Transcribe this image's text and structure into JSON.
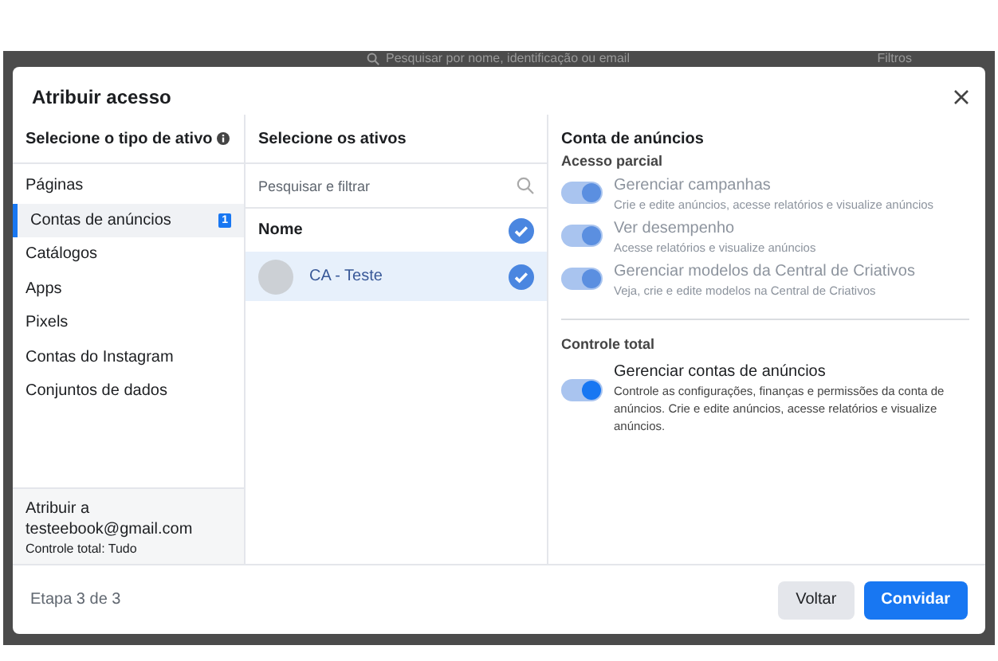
{
  "background": {
    "search_text": "Pesquisar por nome, identificação ou email",
    "filters_label": "Filtros"
  },
  "dialog": {
    "title": "Atribuir acesso"
  },
  "asset_types": {
    "heading": "Selecione o tipo de ativo",
    "items": [
      {
        "label": "Páginas",
        "selected": false
      },
      {
        "label": "Contas de anúncios",
        "selected": true,
        "badge": "1"
      },
      {
        "label": "Catálogos",
        "selected": false
      },
      {
        "label": "Apps",
        "selected": false
      },
      {
        "label": "Pixels",
        "selected": false
      },
      {
        "label": "Contas do Instagram",
        "selected": false
      },
      {
        "label": "Conjuntos de dados",
        "selected": false
      }
    ],
    "summary": {
      "label": "Atribuir a",
      "email": "testeebook@gmail.com",
      "detail": "Controle total: Tudo"
    }
  },
  "assets": {
    "heading": "Selecione os ativos",
    "search": {
      "placeholder": "Pesquisar e filtrar"
    },
    "column_header": {
      "label": "Nome",
      "checked": true
    },
    "items": [
      {
        "name": "CA - Teste",
        "checked": true,
        "selected": true
      }
    ]
  },
  "permissions": {
    "heading": "Conta de anúncios",
    "sections": [
      {
        "title": "Acesso parcial",
        "items": [
          {
            "title": "Gerenciar campanhas",
            "description": "Crie e edite anúncios, acesse relatórios e visualize anúncios",
            "on": true,
            "disabled": true
          },
          {
            "title": "Ver desempenho",
            "description": "Acesse relatórios e visualize anúncios",
            "on": true,
            "disabled": true
          },
          {
            "title": "Gerenciar modelos da Central de Criativos",
            "description": "Veja, crie e edite modelos na Central de Criativos",
            "on": true,
            "disabled": true
          }
        ]
      },
      {
        "title": "Controle total",
        "items": [
          {
            "title": "Gerenciar contas de anúncios",
            "description": "Controle as configurações, finanças e permissões da conta de anúncios. Crie e edite anúncios, acesse relatórios e visualize anúncios.",
            "on": true,
            "disabled": false
          }
        ]
      }
    ]
  },
  "footer": {
    "step": "Etapa 3 de 3",
    "buttons": [
      {
        "label": "Voltar",
        "kind": "secondary"
      },
      {
        "label": "Convidar",
        "kind": "primary"
      }
    ]
  }
}
